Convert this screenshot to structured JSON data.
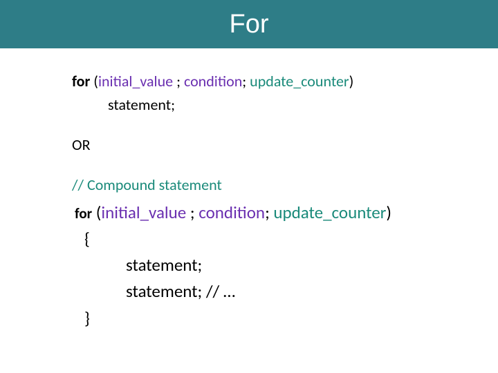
{
  "title": "For",
  "syntax1": {
    "keyword": "for",
    "open": " (",
    "initial": "initial_value",
    "sep1": " ; ",
    "condition": "condition",
    "sep2": "; ",
    "update": "update_counter",
    "close": ")",
    "statement": "statement;"
  },
  "or_label": "OR",
  "comment": "// Compound statement",
  "syntax2": {
    "keyword": "for",
    "open": " (",
    "initial": "initial_value",
    "sep1": " ; ",
    "condition": "condition",
    "sep2": "; ",
    "update": "update_counter",
    "close": ")",
    "open_brace": "{",
    "statement1": "statement;",
    "statement2": "statement; // …",
    "close_brace": "}"
  }
}
